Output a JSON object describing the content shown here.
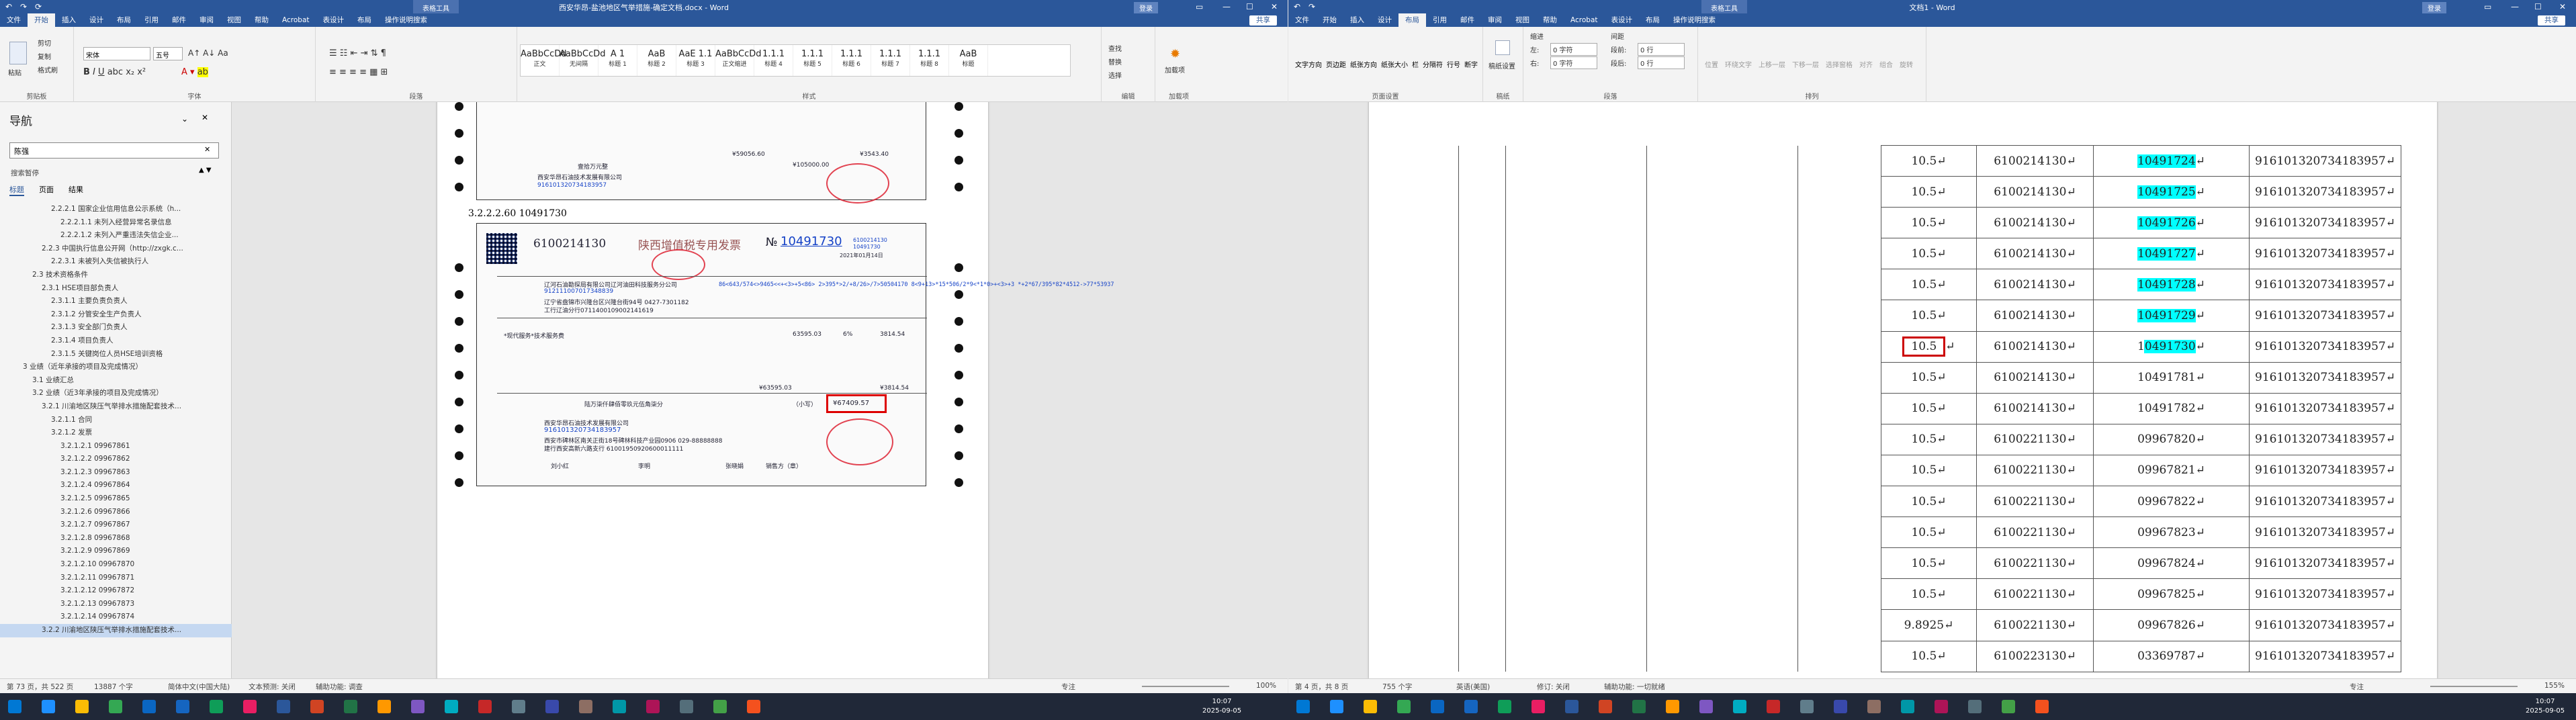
{
  "left_window": {
    "title": "西安华昂-盐池地区气举措施-确定文档.docx - Word",
    "context_tab": "表格工具",
    "account_badge": "登录",
    "share_label": "共享",
    "tabs": [
      "文件",
      "开始",
      "插入",
      "设计",
      "布局",
      "引用",
      "邮件",
      "审阅",
      "视图",
      "帮助",
      "Acrobat",
      "表设计",
      "布局",
      "操作说明搜索"
    ],
    "active_tab": "开始",
    "ribbon": {
      "clipboard": {
        "label": "剪贴板",
        "paste": "粘贴",
        "cut": "剪切",
        "copy": "复制",
        "format_painter": "格式刷"
      },
      "font": {
        "label": "字体",
        "font_name": "宋体",
        "font_size": "五号"
      },
      "paragraph": {
        "label": "段落"
      },
      "styles": {
        "label": "样式",
        "items": [
          {
            "preview": "AaBbCcDd",
            "name": "正文"
          },
          {
            "preview": "AaBbCcDd",
            "name": "无间隔"
          },
          {
            "preview": "A 1",
            "name": "标题 1"
          },
          {
            "preview": "AaB",
            "name": "标题 2"
          },
          {
            "preview": "AaE 1.1",
            "name": "标题 3"
          },
          {
            "preview": "AaBbCcDd",
            "name": "正文缩进"
          },
          {
            "preview": "1.1.1",
            "name": "标题 4"
          },
          {
            "preview": "1.1.1",
            "name": "标题 5"
          },
          {
            "preview": "1.1.1",
            "name": "标题 6"
          },
          {
            "preview": "1.1.1",
            "name": "标题 7"
          },
          {
            "preview": "1.1.1",
            "name": "标题 8"
          },
          {
            "preview": "AaB",
            "name": "标题"
          }
        ]
      },
      "editing": {
        "label": "编辑",
        "find": "查找",
        "replace": "替换",
        "select": "选择"
      },
      "addin": {
        "label": "加载项",
        "name": "加载项"
      }
    },
    "nav": {
      "title": "导航",
      "search_value": "陈强",
      "result_text": "搜索暂停",
      "tabs": [
        "标题",
        "页面",
        "结果"
      ],
      "items": [
        "2.2.2.1 国家企业信用信息公示系统（h...",
        "2.2.2.1.1 未列入经营异常名录信息",
        "2.2.2.1.2 未列入严重违法失信企业...",
        "2.2.3 中国执行信息公开网（http://zxgk.c...",
        "2.2.3.1 未被列入失信被执行人",
        "2.3 技术资格条件",
        "2.3.1 HSE项目部负责人",
        "2.3.1.1 主要负责负责人",
        "2.3.1.2 分管安全生产负责人",
        "2.3.1.3 安全部门负责人",
        "2.3.1.4 项目负责人",
        "2.3.1.5 关键岗位人员HSE培训资格",
        "3 业绩（近年承接的项目及完成情况）",
        "3.1 业绩汇总",
        "3.2 业绩（近3年承接的项目及完成情况）",
        "3.2.1 川渝地区陕压气举排水措施配套技术...",
        "3.2.1.1 合同",
        "3.2.1.2 发票",
        "3.2.1.2.1 09967861",
        "3.2.1.2.2 09967862",
        "3.2.1.2.3 09967863",
        "3.2.1.2.4 09967864",
        "3.2.1.2.5 09967865",
        "3.2.1.2.6 09967866",
        "3.2.1.2.7 09967867",
        "3.2.1.2.8 09967868",
        "3.2.1.2.9 09967869",
        "3.2.1.2.10 09967870",
        "3.2.1.2.11 09967871",
        "3.2.1.2.12 09967872",
        "3.2.1.2.13 09967873",
        "3.2.1.2.14 09967874",
        "3.2.2 川渝地区陕压气举排水措施配套技术..."
      ]
    },
    "document": {
      "heading": "3.2.2.2.60 10491730",
      "upper_invoice_totals": {
        "tax_total": "¥59056.60",
        "grand_total": "¥3543.40",
        "in_words": "壹拾万元整",
        "small_amount": "¥105000.00"
      },
      "upper_invoice_seller": "西安华昂石油技术发展有限公司",
      "upper_invoice_seller_tax": "916101320734183957",
      "invoice": {
        "code": "6100214130",
        "title": "陕西增值税专用发票",
        "number_label": "№",
        "number": "10491730",
        "number_small": "6100214130",
        "number_small2": "10491730",
        "date": "2021年01月14日",
        "buyer": "辽河石油勘探局有限公司辽河油田科技服务分公司",
        "buyer_tax": "912111007017348839",
        "buyer_address": "辽宁省盘锦市兴隆台区兴隆台街94号 0427-7301182",
        "buyer_bank": "工行辽油分行0711400109002141619",
        "password_area": "86<643/574<>9465<<+<3>+5<86>\n2>395*>2/+8/26>/7>50504170\n8<9+13>*15*506/2*9<*1*0>+<3>+3\n*+2*67/395*82*4512->77*53937",
        "service": "*现代服务*技术服务费",
        "amount": "63595.03",
        "tax_rate": "6%",
        "tax": "3814.54",
        "total_amount": "¥63595.03",
        "total_tax": "¥3814.54",
        "in_words": "陆万柒仟肆佰零玖元伍角柒分",
        "small_label": "（小写）",
        "small_amount": "¥67409.57",
        "seller": "西安华昂石油技术发展有限公司",
        "seller_tax": "916101320734183957",
        "seller_address": "西安市碑林区南关正街18号碑林科技产业园0906 029-88888888",
        "seller_bank": "建行西安高新六路支行 61001950920600011111",
        "payee": "刘小红",
        "reviewer": "李明",
        "drawer": "张晓娟",
        "seller_stamp": "销售方（章）"
      }
    },
    "status": {
      "page": "第 73 页，共 522 页",
      "words": "13887 个字",
      "language": "简体中文(中国大陆)",
      "text_pred": "文本预测: 关闭",
      "accessibility": "辅助功能: 调查",
      "focus": "专注",
      "zoom": "100%"
    }
  },
  "right_window": {
    "title": "文档1 - Word",
    "context_tab": "表格工具",
    "account_badge": "登录",
    "share_label": "共享",
    "tabs": [
      "文件",
      "开始",
      "插入",
      "设计",
      "布局",
      "引用",
      "邮件",
      "审阅",
      "视图",
      "帮助",
      "Acrobat",
      "表设计",
      "布局",
      "操作说明搜索"
    ],
    "active_tab": "布局",
    "ribbon": {
      "page_setup": {
        "label": "页面设置",
        "items": [
          "文字方向",
          "页边距",
          "纸张方向",
          "纸张大小",
          "栏",
          "分隔符",
          "行号",
          "断字"
        ]
      },
      "manuscript": {
        "label": "稿纸",
        "item": "稿纸设置"
      },
      "paragraph": {
        "label": "段落",
        "indent": "缩进",
        "spacing": "间距",
        "left_label": "左:",
        "left_value": "0 字符",
        "right_label": "右:",
        "right_value": "0 字符",
        "before_label": "段前:",
        "before_value": "0 行",
        "after_label": "段后:",
        "after_value": "0 行"
      },
      "arrange": {
        "label": "排列",
        "items": [
          "位置",
          "环绕文字",
          "上移一层",
          "下移一层",
          "选择窗格",
          "对齐",
          "组合",
          "旋转"
        ]
      }
    },
    "table": {
      "rows": [
        {
          "amount": "10.5",
          "code": "6100214130",
          "number": "10491724",
          "tax_id": "916101320734183957",
          "hl": true,
          "box": false
        },
        {
          "amount": "10.5",
          "code": "6100214130",
          "number": "10491725",
          "tax_id": "916101320734183957",
          "hl": true,
          "box": false
        },
        {
          "amount": "10.5",
          "code": "6100214130",
          "number": "10491726",
          "tax_id": "916101320734183957",
          "hl": true,
          "box": false
        },
        {
          "amount": "10.5",
          "code": "6100214130",
          "number": "10491727",
          "tax_id": "916101320734183957",
          "hl": true,
          "box": false
        },
        {
          "amount": "10.5",
          "code": "6100214130",
          "number": "10491728",
          "tax_id": "916101320734183957",
          "hl": true,
          "box": false
        },
        {
          "amount": "10.5",
          "code": "6100214130",
          "number": "10491729",
          "tax_id": "916101320734183957",
          "hl": true,
          "box": false
        },
        {
          "amount": "10.5",
          "code": "6100214130",
          "number": "10491730",
          "tax_id": "916101320734183957",
          "hl": true,
          "box": true
        },
        {
          "amount": "10.5",
          "code": "6100214130",
          "number": "10491781",
          "tax_id": "916101320734183957",
          "hl": false,
          "box": false
        },
        {
          "amount": "10.5",
          "code": "6100214130",
          "number": "10491782",
          "tax_id": "916101320734183957",
          "hl": false,
          "box": false
        },
        {
          "amount": "10.5",
          "code": "6100221130",
          "number": "09967820",
          "tax_id": "916101320734183957",
          "hl": false,
          "box": false
        },
        {
          "amount": "10.5",
          "code": "6100221130",
          "number": "09967821",
          "tax_id": "916101320734183957",
          "hl": false,
          "box": false
        },
        {
          "amount": "10.5",
          "code": "6100221130",
          "number": "09967822",
          "tax_id": "916101320734183957",
          "hl": false,
          "box": false
        },
        {
          "amount": "10.5",
          "code": "6100221130",
          "number": "09967823",
          "tax_id": "916101320734183957",
          "hl": false,
          "box": false
        },
        {
          "amount": "10.5",
          "code": "6100221130",
          "number": "09967824",
          "tax_id": "916101320734183957",
          "hl": false,
          "box": false
        },
        {
          "amount": "10.5",
          "code": "6100221130",
          "number": "09967825",
          "tax_id": "916101320734183957",
          "hl": false,
          "box": false
        },
        {
          "amount": "9.8925",
          "code": "6100221130",
          "number": "09967826",
          "tax_id": "916101320734183957",
          "hl": false,
          "box": false
        },
        {
          "amount": "10.5",
          "code": "6100223130",
          "number": "03369787",
          "tax_id": "916101320734183957",
          "hl": false,
          "box": false
        }
      ]
    },
    "status": {
      "page": "第 4 页，共 8 页",
      "words": "755 个字",
      "language": "英语(美国)",
      "text_pred": "修订: 关闭",
      "accessibility": "辅助功能: 一切就绪",
      "focus": "专注",
      "zoom": "155%"
    }
  },
  "taskbar": {
    "time": "10:07",
    "date": "2025-09-05",
    "time2": "10:07",
    "date2": "2025-09-05"
  }
}
